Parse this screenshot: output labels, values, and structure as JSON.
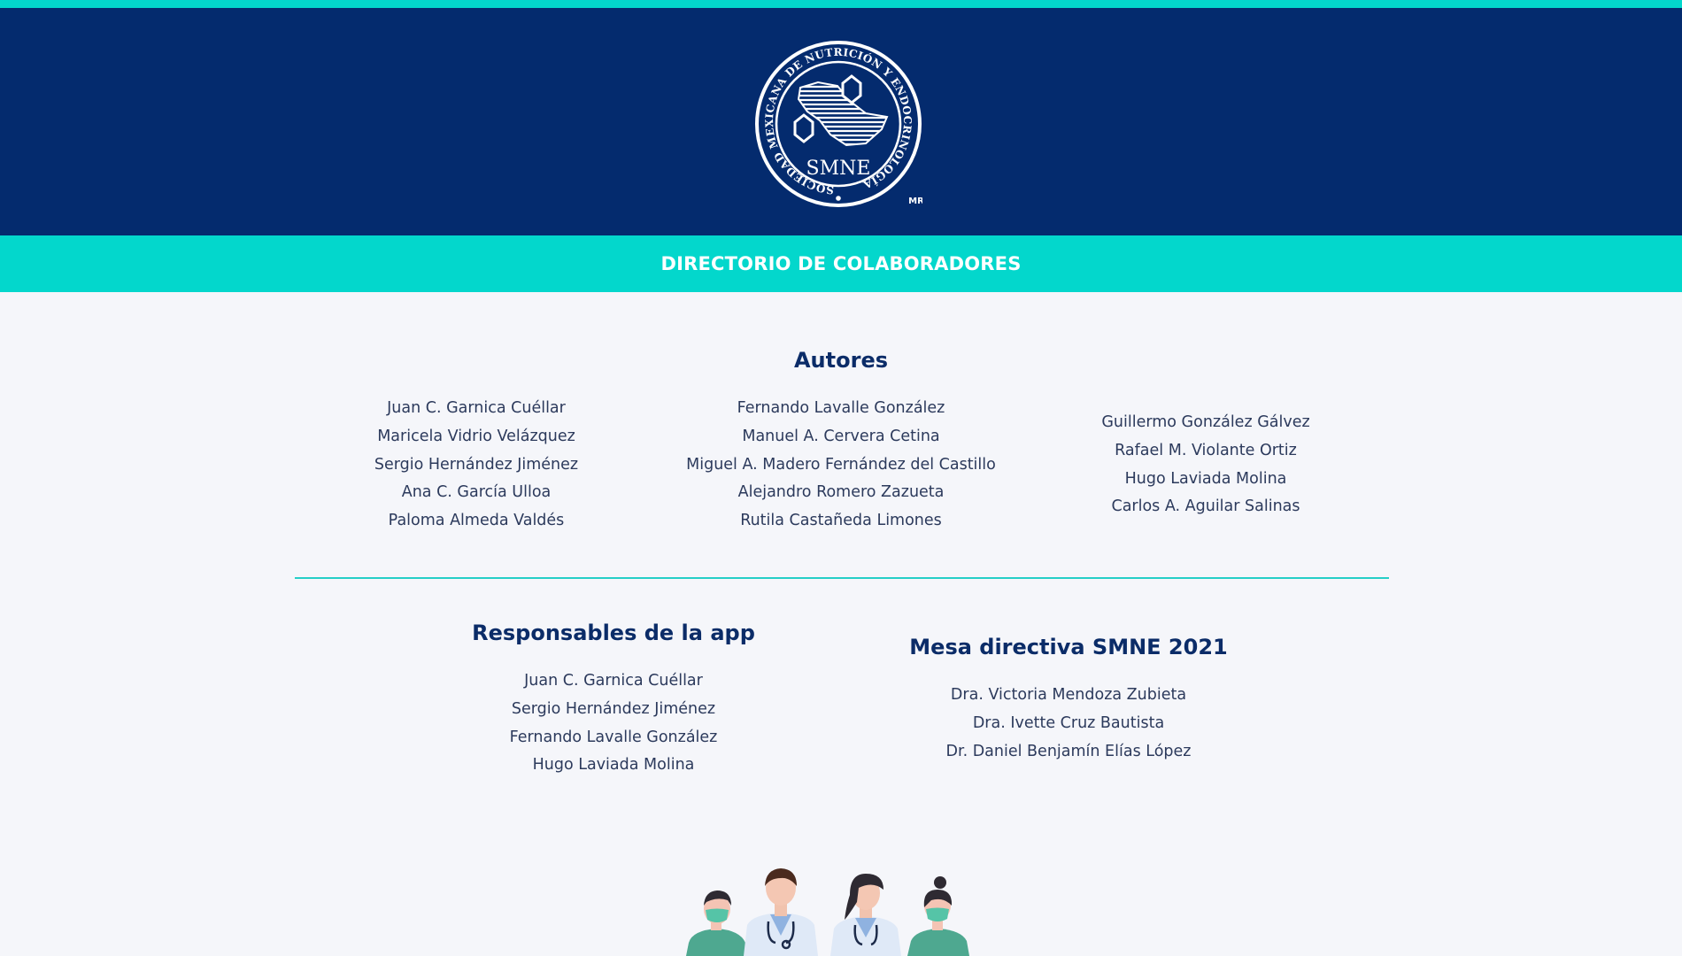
{
  "header": {
    "logo_ring_text": "SOCIEDAD MEXICANA DE NUTRICIÓN Y ENDOCRINOLOGÍA",
    "logo_abbrev": "SMNE",
    "logo_mark": "MR",
    "logo_icon": "smne-seal-icon"
  },
  "banner": {
    "title": "DIRECTORIO DE COLABORADORES"
  },
  "autores": {
    "title": "Autores",
    "col1": [
      "Juan C. Garnica Cuéllar",
      "Maricela Vidrio Velázquez",
      "Sergio Hernández Jiménez",
      "Ana C. García Ulloa",
      "Paloma Almeda Valdés"
    ],
    "col2": [
      "Fernando Lavalle González",
      "Manuel A. Cervera Cetina",
      "Miguel A. Madero Fernández del Castillo",
      "Alejandro Romero Zazueta",
      "Rutila Castañeda Limones"
    ],
    "col3": [
      "Guillermo González Gálvez",
      "Rafael M. Violante Ortiz",
      "Hugo Laviada Molina",
      "Carlos A. Aguilar Salinas"
    ]
  },
  "responsables": {
    "title": "Responsables de la app",
    "names": [
      "Juan C. Garnica Cuéllar",
      "Sergio Hernández Jiménez",
      "Fernando Lavalle González",
      "Hugo Laviada Molina"
    ]
  },
  "mesa": {
    "title": "Mesa directiva SMNE 2021",
    "names": [
      "Dra. Victoria Mendoza Zubieta",
      "Dra. Ivette Cruz Bautista",
      "Dr. Daniel Benjamín Elías López"
    ]
  },
  "illustration": {
    "icon": "medical-team-illustration-icon"
  },
  "colors": {
    "navy": "#042b6e",
    "teal": "#03d7cc",
    "background": "#f5f6fa",
    "heading": "#0b2c68",
    "text": "#2c3a5c"
  }
}
